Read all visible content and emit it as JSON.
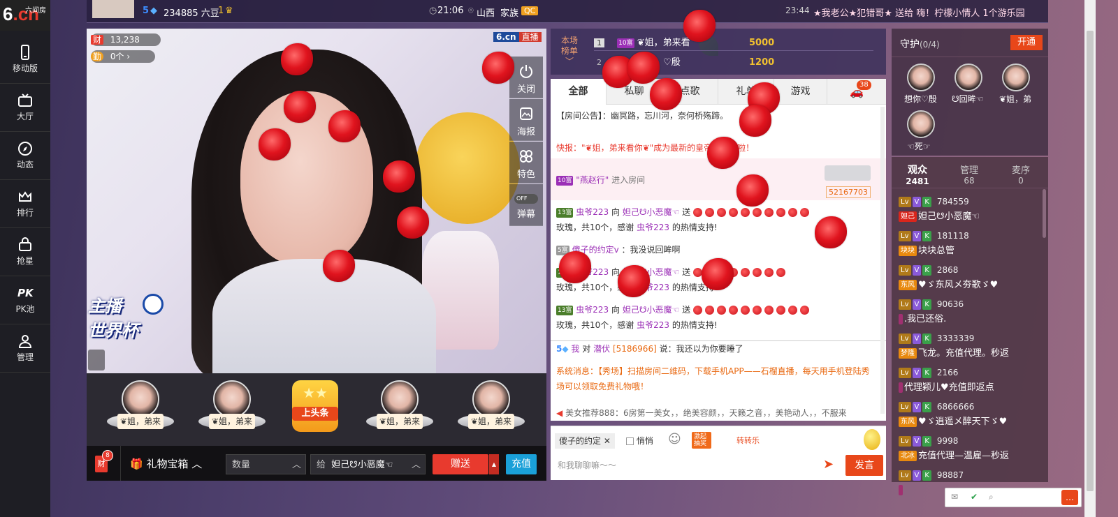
{
  "logo": {
    "text_main": "6.cn",
    "text_small": "六间房"
  },
  "sidebar": {
    "items": [
      {
        "label": "移动版",
        "icon": "mobile-icon"
      },
      {
        "label": "大厅",
        "icon": "tv-icon"
      },
      {
        "label": "动态",
        "icon": "compass-icon"
      },
      {
        "label": "排行",
        "icon": "crown-icon"
      },
      {
        "label": "抢星",
        "icon": "basket-icon"
      },
      {
        "label": "PK池",
        "icon": "pk-icon"
      },
      {
        "label": "管理",
        "icon": "admin-icon"
      }
    ]
  },
  "topbar": {
    "level": "5",
    "coins": "234885 六豆",
    "rank_num": "1",
    "time": "21:06",
    "location": "山西",
    "family_label": "家族",
    "family_tag": "QC",
    "msg_time": "23:44",
    "broadcast": "★我老公★犯错哥★ 送给 嗨！柠檬小情人 1个游乐园"
  },
  "video": {
    "fortune_label": "财",
    "fortune_count": "13,238",
    "diligent_label": "勤",
    "diligent_count": "0个",
    "brand": "6.cn",
    "live": "直播",
    "buttons": [
      "关闭",
      "海报",
      "特色",
      "弹幕"
    ],
    "danmu_toggle": "OFF",
    "worldcup_line1": "主播",
    "worldcup_line2": "世界杯"
  },
  "strip": {
    "anchor_name": "❦姐，弟来",
    "headline": "上头条"
  },
  "bottombar": {
    "fortune_badge": "8",
    "fortune_label": "财",
    "giftbox": "礼物宝箱",
    "qty_placeholder": "数量",
    "to_label": "给",
    "recipient": "妲己☋小恶魔☜",
    "give": "赠送",
    "recharge": "充值"
  },
  "rank": {
    "title_line1": "本场",
    "title_line2": "榜单",
    "rows": [
      {
        "n": "1",
        "tier": "10富",
        "name": "❦姐，弟来看",
        "score": "5000"
      },
      {
        "n": "2",
        "tier": "",
        "name": "♡殷",
        "score": "1200"
      }
    ]
  },
  "tabs": [
    {
      "label": "全部"
    },
    {
      "label": "私聊"
    },
    {
      "label": "点歌"
    },
    {
      "label": "礼单"
    },
    {
      "label": "游戏"
    },
    {
      "label": "",
      "badge": "38"
    }
  ],
  "chat": {
    "notice": "【房间公告】：幽冥路，忘川河，奈何桥殇蹄。",
    "flash": "快报：\"❦姐，弟来看你❦\"成为最新的皇帝，恭喜啦！",
    "enter_tier": "10富",
    "enter_name": "\"燕赵行\"",
    "enter_text": "进入房间",
    "enter_id": "52167703",
    "gift1_tier": "13富",
    "gift1_sender": "虫爷223",
    "gift1_to": "向",
    "gift1_recipient": "妲己☋小恶魔☜",
    "gift1_send": "送",
    "gift1_line2a": "玫瑰，共10个，感谢",
    "gift1_line2b": "虫爷223",
    "gift1_line2c": "的热情支持!",
    "say_tier": "5富",
    "say_name": "傻子的约定v",
    "say_text": "：我没说回眸啊",
    "gift2_tier": "13富",
    "gift2_sender": "虫爷223",
    "gift2_to": "向",
    "gift2_recipient": "妲己☋小恶魔☜",
    "gift2_send": "送",
    "gift2_line2a": "玫瑰，共10个，感谢",
    "gift2_line2b": "虫爷223",
    "gift2_line2c": "的热情支持!",
    "gift3_tier": "13富",
    "gift3_sender": "虫爷223",
    "gift3_to": "向",
    "gift3_recipient": "妲己☋小恶魔☜",
    "gift3_send": "送",
    "gift3_line2a": "玫瑰，共10个，感谢",
    "gift3_line2b": "虫爷223",
    "gift3_line2c": "的热情支持!",
    "me_level": "5",
    "me_name": "我",
    "me_to": "对",
    "me_target": "潜伏",
    "me_id": "[5186966]",
    "me_text": "说：我还以为你要睡了",
    "system": "系统消息：【秀场】扫描房间二维码，下载手机APP——石榴直播，每天用手机登陆秀场可以领取免费礼物哦！",
    "recommend": "美女推荐888：6房第一美女，，绝美容颜，，天籁之音，，美艳动人，，不服来"
  },
  "chatinput": {
    "target": "傻子的约定",
    "whisper": "悄悄",
    "game1": "激起抽奖",
    "game2": "转转乐",
    "placeholder": "和我聊聊嘛～～",
    "send": "发言"
  },
  "guard": {
    "title": "守护",
    "count": "(0/4)",
    "open": "开通",
    "members": [
      "想你♡殷",
      "☋回眸☜",
      "❦姐，弟",
      "☜死☞"
    ]
  },
  "audience": {
    "tabs": [
      {
        "label": "观众",
        "count": "2481"
      },
      {
        "label": "管理",
        "count": "68"
      },
      {
        "label": "麦序",
        "count": "0"
      }
    ],
    "users": [
      {
        "id": "784559",
        "tag": "妲己",
        "name": "妲己☋小恶魔☜",
        "tag_color": "#d9261c"
      },
      {
        "id": "181118",
        "tag": "块块",
        "name": "块块总管",
        "tag_color": "#e8890f"
      },
      {
        "id": "2868",
        "tag": "东风",
        "name": "♥ゞ东风メ夯歌ゞ♥",
        "tag_color": "#e8890f"
      },
      {
        "id": "90636",
        "tag": "",
        "name": ".我已还俗.",
        "tag_color": "#a03070"
      },
      {
        "id": "3333339",
        "tag": "梦隆",
        "name": "飞龙。充值代理。秒返",
        "tag_color": "#e8890f"
      },
      {
        "id": "2166",
        "tag": "",
        "name": "代理颖儿♥充值即返点",
        "tag_color": "#a03070"
      },
      {
        "id": "6866666",
        "tag": "东风",
        "name": "♥ゞ逍遥メ醉天下ゞ♥",
        "tag_color": "#e8890f"
      },
      {
        "id": "9998",
        "tag": "北冰",
        "name": "充值代理—温雇—秒返",
        "tag_color": "#e8890f"
      },
      {
        "id": "98887",
        "tag": "",
        "name": "",
        "tag_color": "#a03070"
      }
    ]
  }
}
